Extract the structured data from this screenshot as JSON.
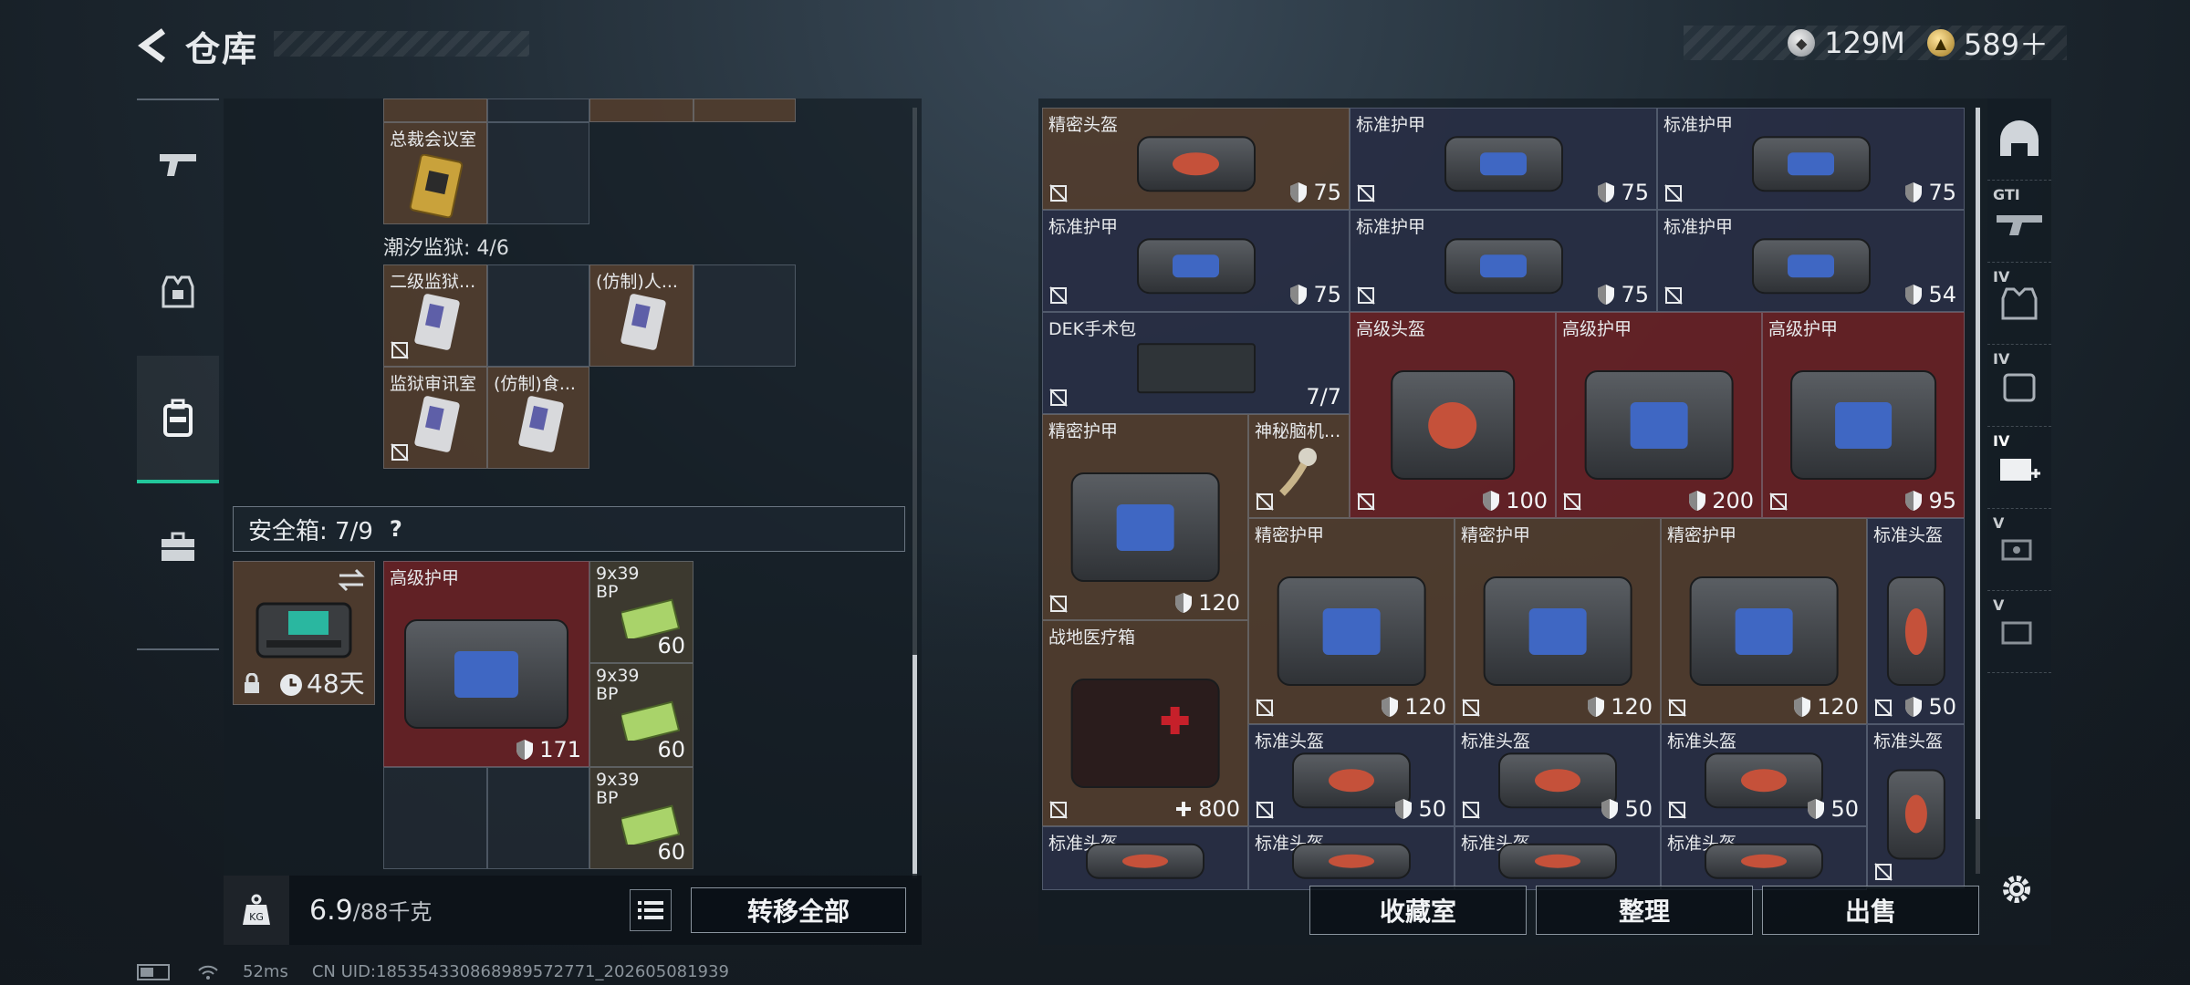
{
  "header": {
    "title": "仓库"
  },
  "currency": [
    {
      "icon": "silver-coin-icon",
      "value": "129M"
    },
    {
      "icon": "gold-coin-icon",
      "value": "589＋"
    }
  ],
  "left": {
    "top_cards": [
      {
        "name": "总裁会议室",
        "style": "brown"
      }
    ],
    "prison_label": "潮汐监狱: 4/6",
    "prison_cards": [
      {
        "name": "二级监狱...",
        "style": "brown"
      },
      {
        "name": "(仿制)人...",
        "style": "brown"
      },
      {
        "name": "监狱审讯室",
        "style": "brown"
      },
      {
        "name": "(仿制)食...",
        "style": "brown"
      }
    ],
    "safe_label": "安全箱: 7/9",
    "safe_help": "?",
    "safe_box_days": "48天",
    "safe_items": [
      {
        "name": "高级护甲",
        "value": "171",
        "style": "red"
      },
      {
        "name": "9x39 BP",
        "value": "60",
        "style": "olive"
      },
      {
        "name": "9x39 BP",
        "value": "60",
        "style": "olive"
      },
      {
        "name": "9x39 BP",
        "value": "60",
        "style": "olive"
      }
    ],
    "weight_value": "6.9",
    "weight_max": "/88千克",
    "transfer_all": "转移全部"
  },
  "right": {
    "items": [
      {
        "name": "精密头盔",
        "value": "75",
        "style": "brown",
        "kind": "helmet"
      },
      {
        "name": "标准护甲",
        "value": "75",
        "style": "blue",
        "kind": "armor"
      },
      {
        "name": "标准护甲",
        "value": "75",
        "style": "blue",
        "kind": "armor"
      },
      {
        "name": "标准护甲",
        "value": "75",
        "style": "blue",
        "kind": "armor"
      },
      {
        "name": "标准护甲",
        "value": "75",
        "style": "blue",
        "kind": "armor"
      },
      {
        "name": "标准护甲",
        "value": "54",
        "style": "blue",
        "kind": "armor"
      },
      {
        "name": "DEK手术包",
        "value": "7/7",
        "style": "blue",
        "kind": "kit"
      },
      {
        "name": "高级头盔",
        "value": "100",
        "style": "red",
        "kind": "helmet"
      },
      {
        "name": "高级护甲",
        "value": "200",
        "style": "red",
        "kind": "armor"
      },
      {
        "name": "高级护甲",
        "value": "95",
        "style": "red",
        "kind": "armor"
      },
      {
        "name": "精密护甲",
        "value": "120",
        "style": "brown",
        "kind": "armor"
      },
      {
        "name": "神秘脑机...",
        "value": "",
        "style": "brown",
        "kind": "chip"
      },
      {
        "name": "精密护甲",
        "value": "120",
        "style": "brown",
        "kind": "armor"
      },
      {
        "name": "精密护甲",
        "value": "120",
        "style": "brown",
        "kind": "armor"
      },
      {
        "name": "精密护甲",
        "value": "120",
        "style": "brown",
        "kind": "armor"
      },
      {
        "name": "标准头盔",
        "value": "50",
        "style": "blue",
        "kind": "helmet"
      },
      {
        "name": "战地医疗箱",
        "value": "800",
        "style": "brown",
        "kind": "medkit"
      },
      {
        "name": "标准头盔",
        "value": "50",
        "style": "blue",
        "kind": "helmet"
      },
      {
        "name": "标准头盔",
        "value": "50",
        "style": "blue",
        "kind": "helmet"
      },
      {
        "name": "标准头盔",
        "value": "50",
        "style": "blue",
        "kind": "helmet"
      },
      {
        "name": "标准头盔",
        "value": "",
        "style": "blue",
        "kind": "helmet"
      },
      {
        "name": "标准头盔",
        "value": "",
        "style": "blue",
        "kind": "helmet"
      },
      {
        "name": "标准头盔",
        "value": "",
        "style": "blue",
        "kind": "helmet"
      },
      {
        "name": "标准头盔",
        "value": "",
        "style": "blue",
        "kind": "helmet"
      },
      {
        "name": "标准头盔",
        "value": "",
        "style": "blue",
        "kind": "helmet"
      }
    ],
    "buttons": {
      "collection": "收藏室",
      "organize": "整理",
      "sell": "出售"
    }
  },
  "right_nav": [
    {
      "icon": "helmet-slot-icon",
      "label": ""
    },
    {
      "icon": "gti-gun-icon",
      "label": "GTI"
    },
    {
      "icon": "tier4-armor-icon",
      "label": "IV"
    },
    {
      "icon": "tier4-backpack-icon",
      "label": "IV"
    },
    {
      "icon": "tier4-medkit-add-icon",
      "label": "IV"
    },
    {
      "icon": "tier5-item-icon",
      "label": "V"
    },
    {
      "icon": "tier5-box-icon",
      "label": "V"
    }
  ],
  "status": {
    "ping": "52ms",
    "uid": "CN UID:18535433086898957277​1_202605081939"
  }
}
